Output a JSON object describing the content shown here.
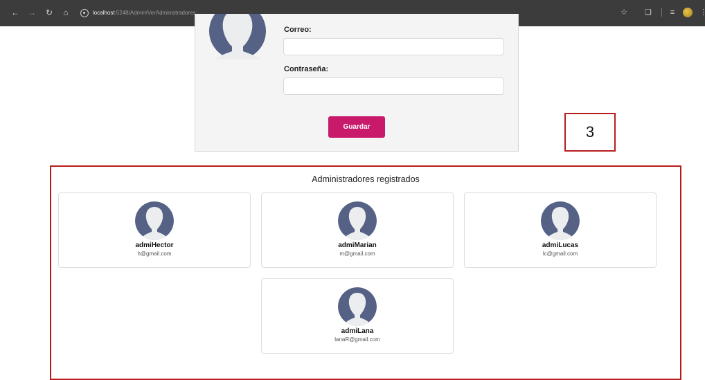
{
  "browser": {
    "url_host": "localhost",
    "url_rest": ":5248/Admin/VerAdministradores"
  },
  "form": {
    "email_label": "Correo:",
    "email_value": "",
    "password_label": "Contraseña:",
    "password_value": "",
    "save_label": "Guardar"
  },
  "annotation": {
    "number": "3"
  },
  "admins": {
    "title": "Administradores registrados",
    "items": [
      {
        "username": "admiHector",
        "email": "h@gmail.com"
      },
      {
        "username": "admiMarian",
        "email": "m@gmail.com"
      },
      {
        "username": "admiLucas",
        "email": "lc@gmail.com"
      },
      {
        "username": "admiLana",
        "email": "lanaR@gmail.com"
      }
    ]
  },
  "colors": {
    "chrome_bg": "#3c3c3c",
    "save_button": "#c8196a",
    "annotation_border": "#b81d1d",
    "avatar_fill": "#556285"
  }
}
